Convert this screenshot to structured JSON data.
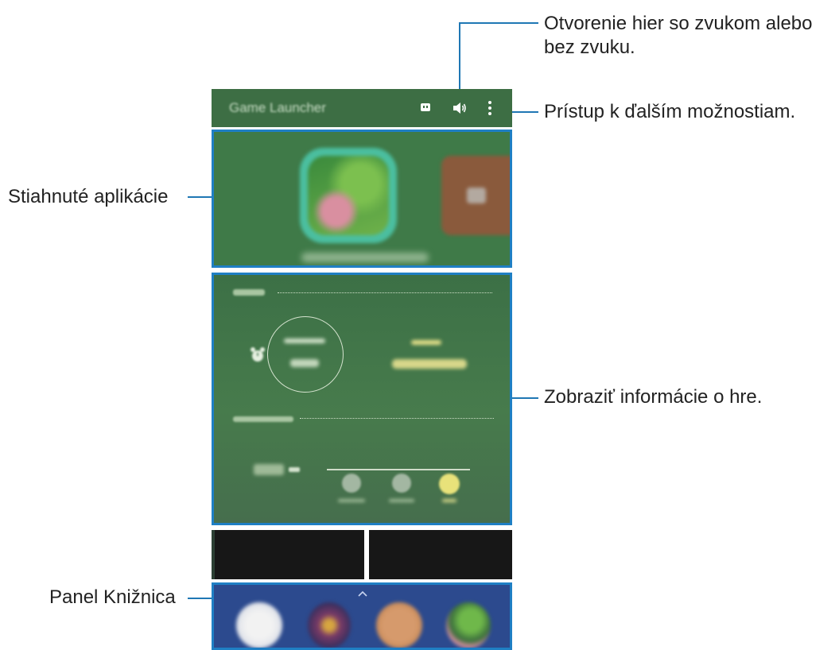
{
  "app": {
    "title": "Game Launcher"
  },
  "toolbar": {
    "icons": [
      "capture-icon",
      "sound-icon",
      "more-options-icon"
    ]
  },
  "callouts": {
    "sound_line1": "Otvorenie hier so zvukom alebo",
    "sound_line2": "bez zvuku.",
    "more_options": "Prístup k ďalším možnostiam.",
    "downloaded_apps": "Stiahnuté aplikácie",
    "game_info": "Zobraziť informácie o hre.",
    "library_panel": "Panel Knižnica"
  },
  "colors": {
    "accent_line": "#1f77b4",
    "app_green": "#3f7a48",
    "library_blue": "#2c4a8e",
    "today_highlight": "#e8e27a"
  }
}
